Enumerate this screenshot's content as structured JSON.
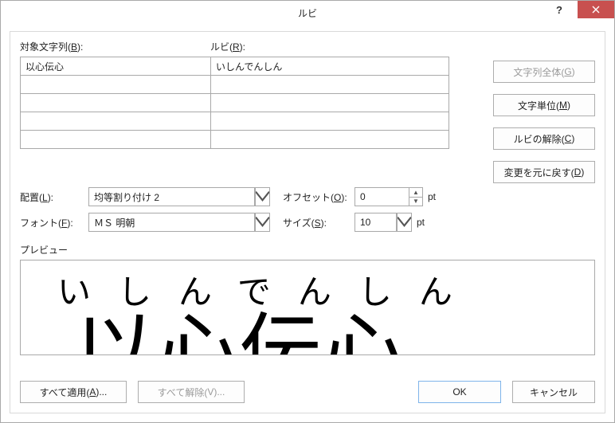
{
  "title": "ルビ",
  "labels": {
    "base": "対象文字列(",
    "base_key": "B",
    "ruby": "ルビ(",
    "ruby_key": "R",
    "close_paren": "):"
  },
  "grid": {
    "rows": [
      {
        "base": "以心伝心",
        "ruby": "いしんでんしん"
      },
      {
        "base": "",
        "ruby": ""
      },
      {
        "base": "",
        "ruby": ""
      },
      {
        "base": "",
        "ruby": ""
      },
      {
        "base": "",
        "ruby": ""
      }
    ]
  },
  "side": {
    "whole": {
      "pre": "文字列全体(",
      "key": "G",
      "post": ")"
    },
    "mono": {
      "pre": "文字単位(",
      "key": "M",
      "post": ")"
    },
    "clear": {
      "pre": "ルビの解除(",
      "key": "C",
      "post": ")"
    },
    "reset": {
      "pre": "変更を元に戻す(",
      "key": "D",
      "post": ")"
    }
  },
  "align": {
    "label_pre": "配置(",
    "label_key": "L",
    "label_post": "):",
    "value": "均等割り付け 2"
  },
  "font": {
    "label_pre": "フォント(",
    "label_key": "F",
    "label_post": "):",
    "value": "ＭＳ 明朝"
  },
  "offset": {
    "label_pre": "オフセット(",
    "label_key": "O",
    "label_post": "):",
    "value": "0",
    "unit": "pt"
  },
  "size": {
    "label_pre": "サイズ(",
    "label_key": "S",
    "label_post": "):",
    "value": "10",
    "unit": "pt"
  },
  "preview": {
    "label": "プレビュー",
    "ruby": "いしんでんしん",
    "base": "以心伝心"
  },
  "footer": {
    "apply_all": {
      "pre": "すべて適用(",
      "key": "A",
      "post": ")..."
    },
    "clear_all": {
      "pre": "すべて解除(",
      "key": "V",
      "post": ")..."
    },
    "ok": "OK",
    "cancel": "キャンセル"
  }
}
